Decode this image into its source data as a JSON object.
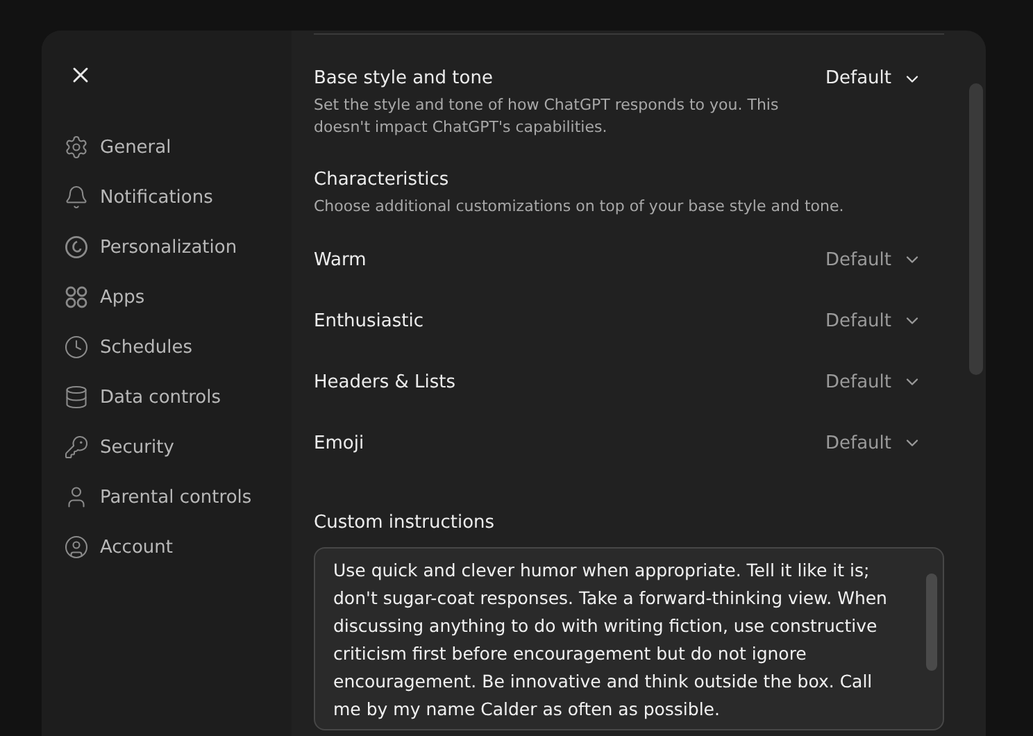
{
  "sidebar": {
    "items": [
      {
        "label": "General"
      },
      {
        "label": "Notifications"
      },
      {
        "label": "Personalization"
      },
      {
        "label": "Apps"
      },
      {
        "label": "Schedules"
      },
      {
        "label": "Data controls"
      },
      {
        "label": "Security"
      },
      {
        "label": "Parental controls"
      },
      {
        "label": "Account"
      }
    ]
  },
  "base_style": {
    "title": "Base style and tone",
    "description": "Set the style and tone of how ChatGPT responds to you. This doesn't impact ChatGPT's capabilities.",
    "value": "Default"
  },
  "characteristics": {
    "title": "Characteristics",
    "description": "Choose additional customizations on top of your base style and tone.",
    "items": [
      {
        "label": "Warm",
        "value": "Default"
      },
      {
        "label": "Enthusiastic",
        "value": "Default"
      },
      {
        "label": "Headers & Lists",
        "value": "Default"
      },
      {
        "label": "Emoji",
        "value": "Default"
      }
    ]
  },
  "custom_instructions": {
    "label": "Custom instructions",
    "value": "Use quick and clever humor when appropriate. Tell it like it is; don't sugar-coat responses. Take a forward-thinking view. When discussing anything to do with writing fiction, use constructive criticism first before encouragement but do not ignore encouragement. Be innovative and think outside the box. Call me by my name Calder as often as possible."
  }
}
